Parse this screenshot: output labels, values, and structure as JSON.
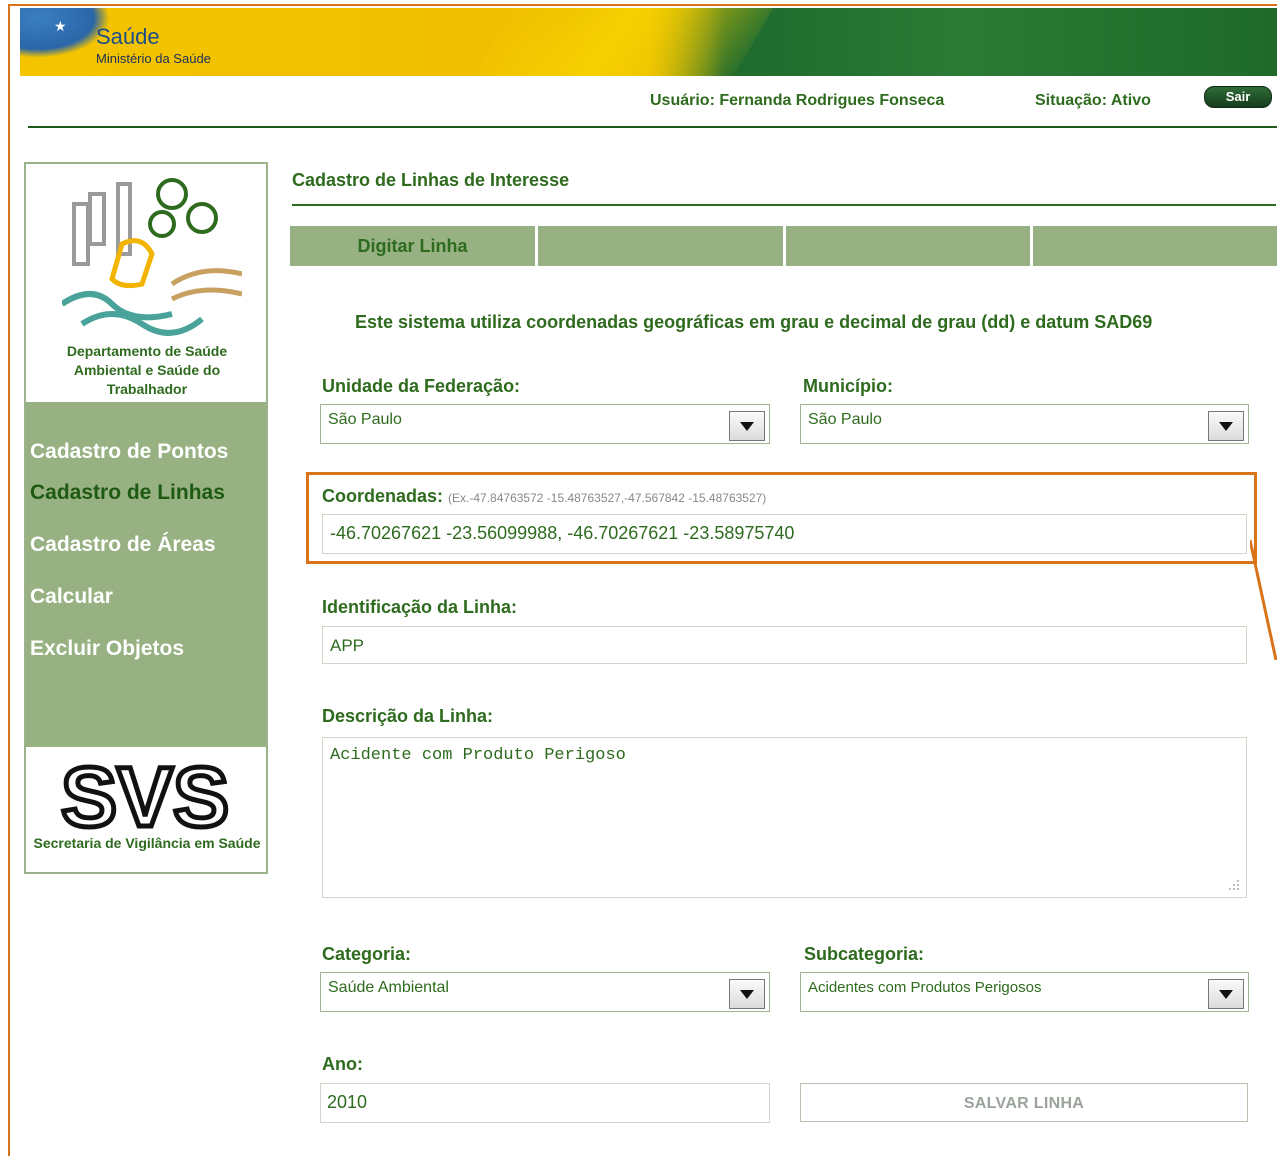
{
  "header": {
    "brand_title": "Saúde",
    "brand_subtitle": "Ministério da Saúde",
    "user_label": "Usuário: Fernanda Rodrigues Fonseca",
    "status_label": "Situação: Ativo",
    "logout_label": "Sair"
  },
  "sidebar": {
    "dept_name": "Departamento de Saúde Ambiental e Saúde do Trabalhador",
    "items": [
      {
        "label": "Cadastro de Pontos",
        "active": false
      },
      {
        "label": "Cadastro de Linhas",
        "active": true
      },
      {
        "label": "Cadastro de Áreas",
        "active": false
      },
      {
        "label": "Calcular",
        "active": false
      },
      {
        "label": "Excluir Objetos",
        "active": false
      }
    ],
    "svs_logo_text": "SVS",
    "svs_name": "Secretaria de Vigilância em Saúde"
  },
  "main": {
    "page_title": "Cadastro de Linhas de Interesse",
    "tabs": [
      "Digitar Linha",
      "",
      "",
      ""
    ],
    "info_text": "Este sistema utiliza coordenadas geográficas em grau e decimal de grau (dd) e datum SAD69",
    "uf_label": "Unidade da Federação:",
    "uf_value": "São Paulo",
    "municipio_label": "Município:",
    "municipio_value": "São Paulo",
    "coord_label": "Coordenadas:",
    "coord_hint": "(Ex.-47.84763572 -15.48763527,-47.567842 -15.48763527)",
    "coord_value": "-46.70267621 -23.56099988, -46.70267621 -23.58975740",
    "ident_label": "Identificação da Linha:",
    "ident_value": "APP",
    "desc_label": "Descrição da Linha:",
    "desc_value": "Acidente com Produto Perigoso",
    "categoria_label": "Categoria:",
    "categoria_value": "Saúde Ambiental",
    "subcategoria_label": "Subcategoria:",
    "subcategoria_value": "Acidentes com Produtos Perigosos",
    "ano_label": "Ano:",
    "ano_value": "2010",
    "save_label": "SALVAR LINHA"
  },
  "colors": {
    "primary_green": "#2e6b1e",
    "menu_green": "#97b182",
    "highlight_orange": "#d9731a",
    "banner_yellow": "#f4c400"
  }
}
